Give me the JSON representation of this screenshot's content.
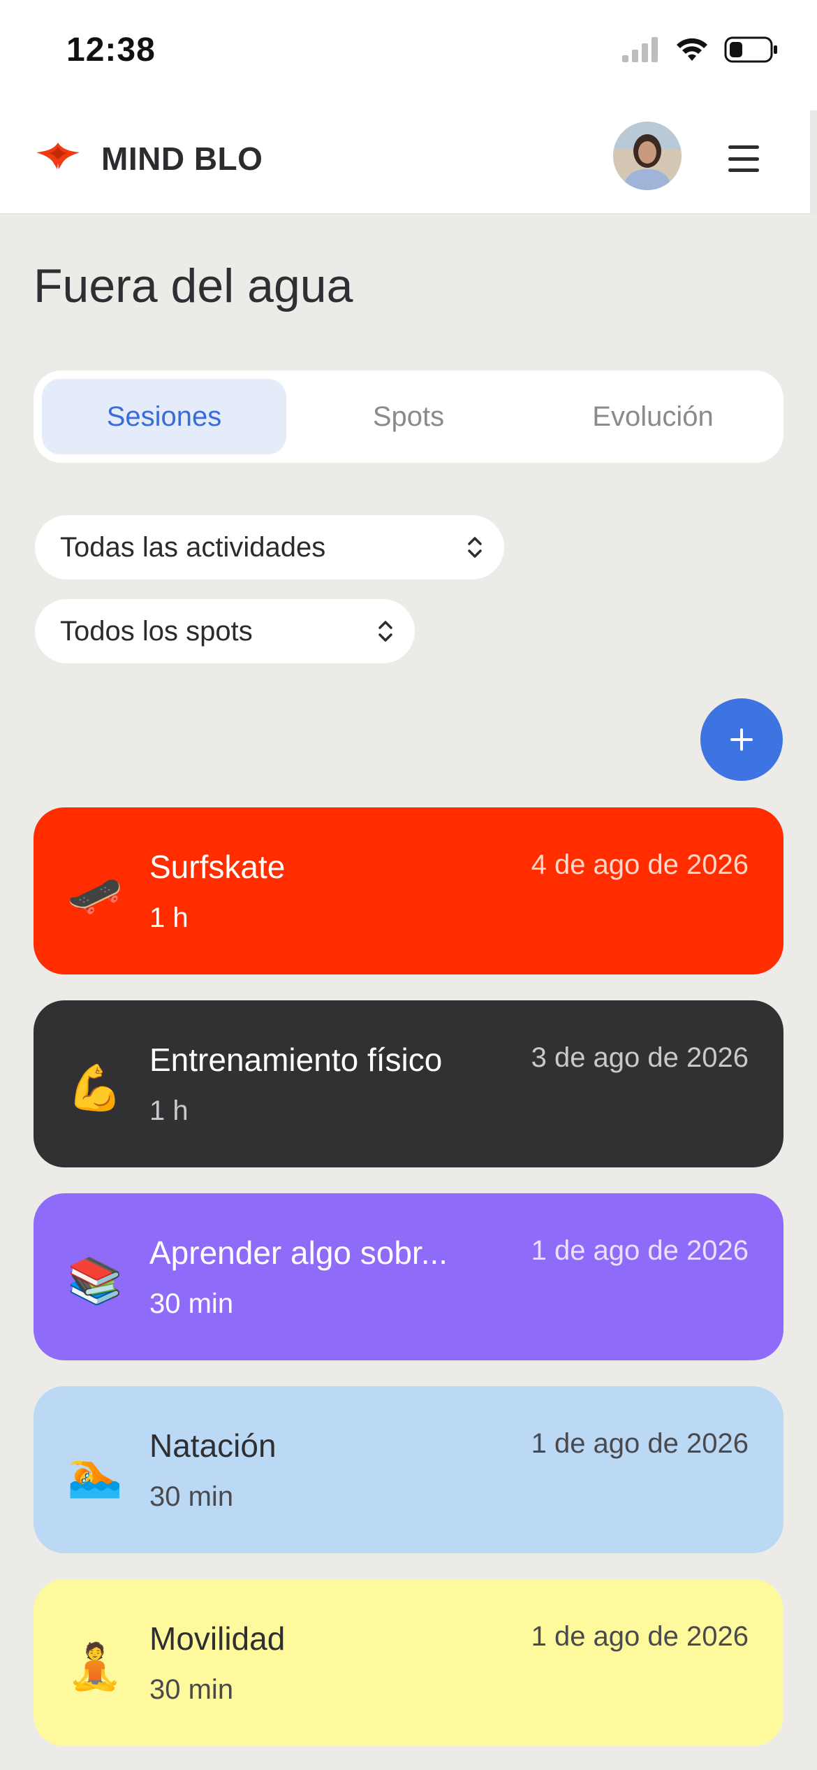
{
  "status_bar": {
    "time": "12:38",
    "icons": [
      "signal-icon",
      "wifi-icon",
      "battery-icon"
    ]
  },
  "header": {
    "brand": "MIND BLO",
    "logo_icon": "manta-ray-logo-icon",
    "avatar": "user-avatar",
    "menu_icon": "hamburger-menu-icon"
  },
  "page": {
    "title": "Fuera del agua"
  },
  "tabs": [
    {
      "label": "Sesiones",
      "active": true
    },
    {
      "label": "Spots",
      "active": false
    },
    {
      "label": "Evolución",
      "active": false
    }
  ],
  "filters": {
    "activity": "Todas las actividades",
    "spot": "Todos los spots"
  },
  "add_button": {
    "icon": "plus-icon"
  },
  "sessions": [
    {
      "icon": "skateboard-icon",
      "emoji": "🛹",
      "name": "Surfskate",
      "date": "4 de ago de 2026",
      "duration": "1 h",
      "color": "#FF2D00"
    },
    {
      "icon": "flexed-biceps-icon",
      "emoji": "💪",
      "name": "Entrenamiento físico",
      "date": "3 de ago de 2026",
      "duration": "1 h",
      "color": "#313133"
    },
    {
      "icon": "books-icon",
      "emoji": "📚",
      "name": "Aprender algo sobr...",
      "date": "1 de ago de 2026",
      "duration": "30 min",
      "color": "#8F6BFA"
    },
    {
      "icon": "swimmer-icon",
      "emoji": "🏊",
      "name": "Natación",
      "date": "1 de ago de 2026",
      "duration": "30 min",
      "color": "#BBD9F4"
    },
    {
      "icon": "yoga-icon",
      "emoji": "🧘",
      "name": "Movilidad",
      "date": "1 de ago de 2026",
      "duration": "30 min",
      "color": "#FDF99C"
    }
  ],
  "colors": {
    "background": "#ECEBE8",
    "accent": "#3E73E2",
    "tab_active_bg": "#E4ECFA",
    "tab_active_text": "#3C6BD8"
  }
}
